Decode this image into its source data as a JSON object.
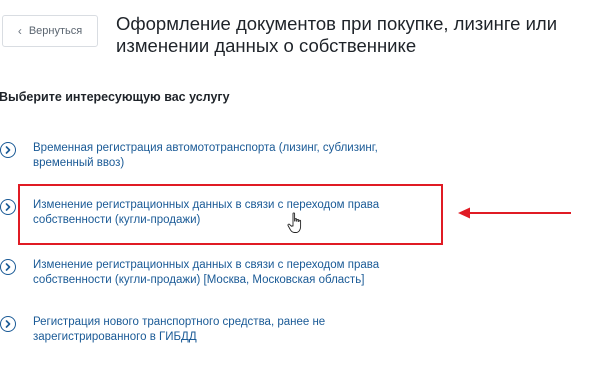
{
  "header": {
    "back_label": "Вернуться",
    "title": "Оформление документов при покупке, лизинге или изменении данных о собственнике"
  },
  "section": {
    "heading": "Выберите интересующую вас услугу"
  },
  "services": [
    {
      "label": "Временная регистрация автомототранспорта (лизинг, сублизинг, временный ввоз)"
    },
    {
      "label": "Изменение регистрационных данных в связи с переходом права собственности (кугли-продажи)"
    },
    {
      "label": "Изменение регистрационных данных в связи с переходом права собственности (кугли-продажи) [Москва, Московская область]"
    },
    {
      "label": "Регистрация нового транспортного средства, ранее не зарегистрированного в ГИБДД"
    }
  ],
  "colors": {
    "link": "#1a5a96",
    "highlight": "#e01b24"
  },
  "icons": {
    "back": "chevron-left-icon",
    "service": "circle-chevron-right-icon",
    "annotation": "red-arrow-left-icon",
    "cursor": "hand-pointer-icon"
  }
}
